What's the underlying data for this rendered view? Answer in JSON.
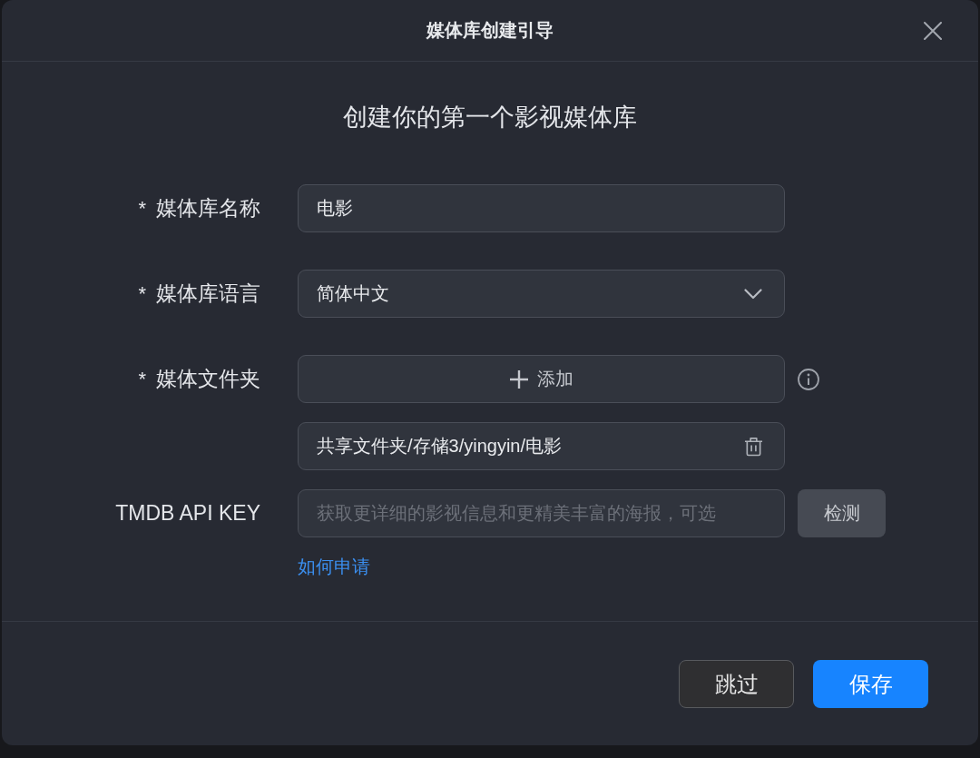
{
  "dialog": {
    "title": "媒体库创建引导"
  },
  "heading": "创建你的第一个影视媒体库",
  "fields": [
    {
      "kind": "text",
      "required_mark": "*",
      "label": "媒体库名称",
      "value": "电影"
    },
    {
      "kind": "select",
      "required_mark": "*",
      "label": "媒体库语言",
      "value": "简体中文"
    },
    {
      "kind": "folder",
      "required_mark": "*",
      "label": "媒体文件夹",
      "add_label": "添加",
      "folders": [
        {
          "path": "共享文件夹/存储3/yingyin/电影"
        }
      ]
    },
    {
      "kind": "key",
      "label": "TMDB API KEY",
      "placeholder": "获取更详细的影视信息和更精美丰富的海报，可选",
      "action_button": "检测",
      "help_link": "如何申请"
    }
  ],
  "buttons": [
    {
      "kind": "secondary",
      "label": "跳过"
    },
    {
      "kind": "primary",
      "label": "保存"
    }
  ]
}
